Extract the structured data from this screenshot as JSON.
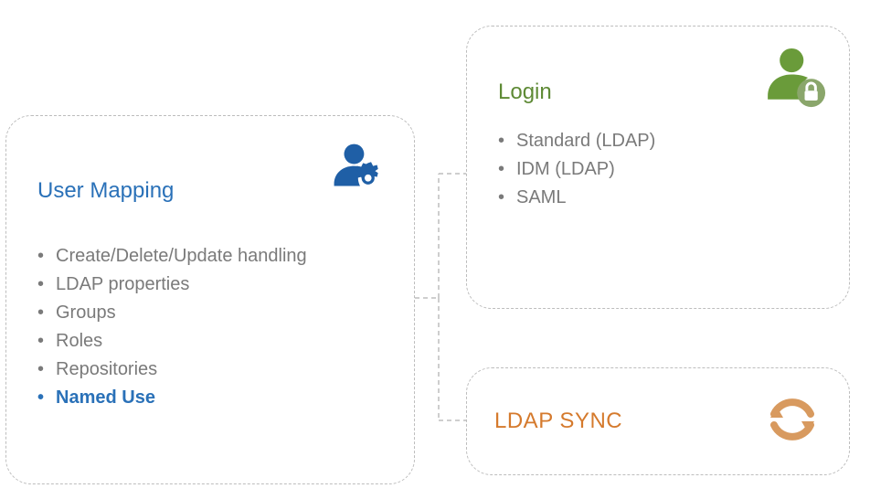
{
  "user_mapping": {
    "title": "User Mapping",
    "icon": "user-gear-icon",
    "title_color": "#2a71b8",
    "items": [
      {
        "label": "Create/Delete/Update handling",
        "accent": false
      },
      {
        "label": "LDAP properties",
        "accent": false
      },
      {
        "label": "Groups",
        "accent": false
      },
      {
        "label": "Roles",
        "accent": false
      },
      {
        "label": "Repositories",
        "accent": false
      },
      {
        "label": "Named Use",
        "accent": true
      }
    ]
  },
  "login": {
    "title": "Login",
    "icon": "user-lock-icon",
    "title_color": "#5e8a35",
    "items": [
      {
        "label": "Standard (LDAP)"
      },
      {
        "label": "IDM (LDAP)"
      },
      {
        "label": "SAML"
      }
    ]
  },
  "ldap_sync": {
    "title": "LDAP SYNC",
    "icon": "sync-icon",
    "title_color": "#d57a2d"
  },
  "colors": {
    "blue": "#2a71b8",
    "green": "#6a9b3a",
    "orange": "#d89a5f",
    "dash": "#bdbdbd",
    "text_muted": "#7a7a7a"
  }
}
